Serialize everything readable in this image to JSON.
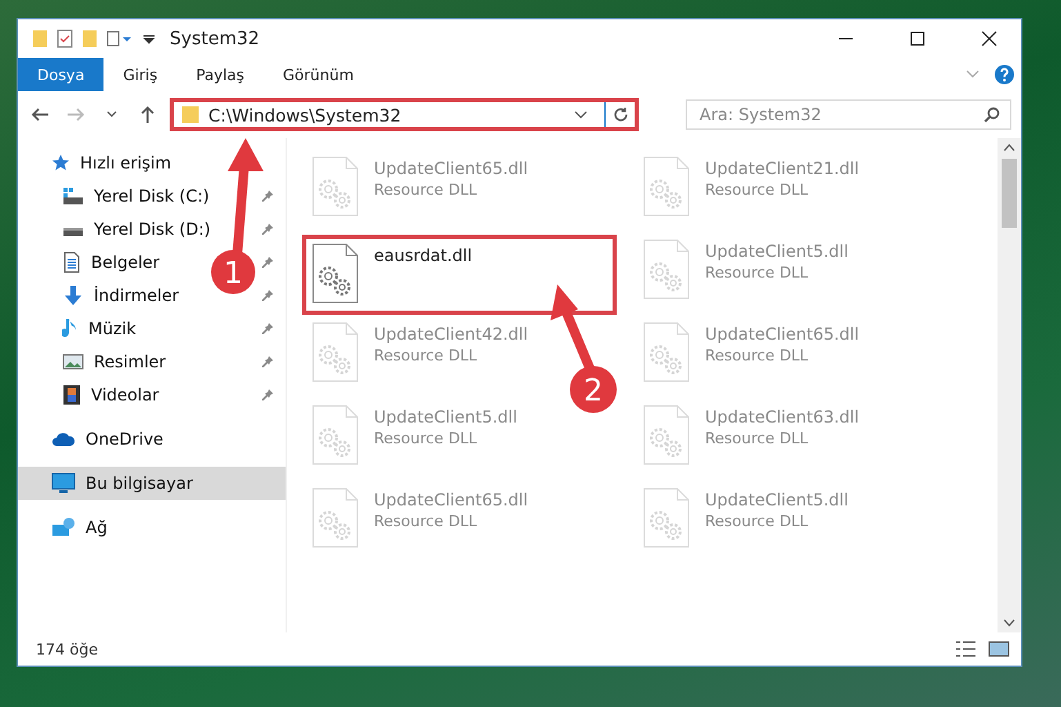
{
  "window": {
    "title": "System32"
  },
  "ribbon_tabs": [
    {
      "label": "Dosya",
      "selected": true
    },
    {
      "label": "Giriş",
      "selected": false
    },
    {
      "label": "Paylaş",
      "selected": false
    },
    {
      "label": "Görünüm",
      "selected": false
    }
  ],
  "address_bar": {
    "path": "C:\\Windows\\System32",
    "annotated": true
  },
  "search": {
    "placeholder": "Ara: System32"
  },
  "sidebar": {
    "items": [
      {
        "label": "Hızlı erişim",
        "kind": "star",
        "selected": false,
        "children": [
          {
            "label": "Yerel Disk (C:)",
            "kind": "drive-win",
            "pinned": true,
            "selected": false
          },
          {
            "label": "Yerel Disk (D:)",
            "kind": "drive",
            "pinned": true,
            "selected": false
          },
          {
            "label": "Belgeler",
            "kind": "document",
            "pinned": true,
            "selected": false
          },
          {
            "label": "İndirmeler",
            "kind": "download",
            "pinned": true,
            "selected": false
          },
          {
            "label": "Müzik",
            "kind": "music",
            "pinned": true,
            "selected": false
          },
          {
            "label": "Resimler",
            "kind": "pictures",
            "pinned": true,
            "selected": false
          },
          {
            "label": "Videolar",
            "kind": "video",
            "pinned": true,
            "selected": false
          }
        ]
      },
      {
        "label": "OneDrive",
        "kind": "cloud",
        "selected": false
      },
      {
        "label": "Bu bilgisayar",
        "kind": "computer",
        "selected": true
      },
      {
        "label": "Ağ",
        "kind": "network",
        "selected": false
      }
    ]
  },
  "files": [
    {
      "name": "UpdateClient65.dll",
      "type": "Resource DLL",
      "faded": true,
      "annotated": false
    },
    {
      "name": "UpdateClient21.dll",
      "type": "Resource DLL",
      "faded": true,
      "annotated": false
    },
    {
      "name": "eausrdat.dll",
      "faded": false,
      "annotated": true
    },
    {
      "name": "UpdateClient5.dll",
      "type": "Resource DLL",
      "faded": true,
      "annotated": false
    },
    {
      "name": "UpdateClient42.dll",
      "type": "Resource DLL",
      "faded": true,
      "annotated": false
    },
    {
      "name": "UpdateClient65.dll",
      "type": "Resource DLL",
      "faded": true,
      "annotated": false
    },
    {
      "name": "UpdateClient5.dll",
      "type": "Resource DLL",
      "faded": true,
      "annotated": false
    },
    {
      "name": "UpdateClient63.dll",
      "type": "Resource DLL",
      "faded": true,
      "annotated": false
    },
    {
      "name": "UpdateClient65.dll",
      "type": "Resource DLL",
      "faded": true,
      "annotated": false
    },
    {
      "name": "UpdateClient5.dll",
      "type": "Resource DLL",
      "faded": true,
      "annotated": false
    }
  ],
  "status_bar": {
    "item_count": "174 öğe"
  },
  "callouts": [
    "1",
    "2"
  ]
}
